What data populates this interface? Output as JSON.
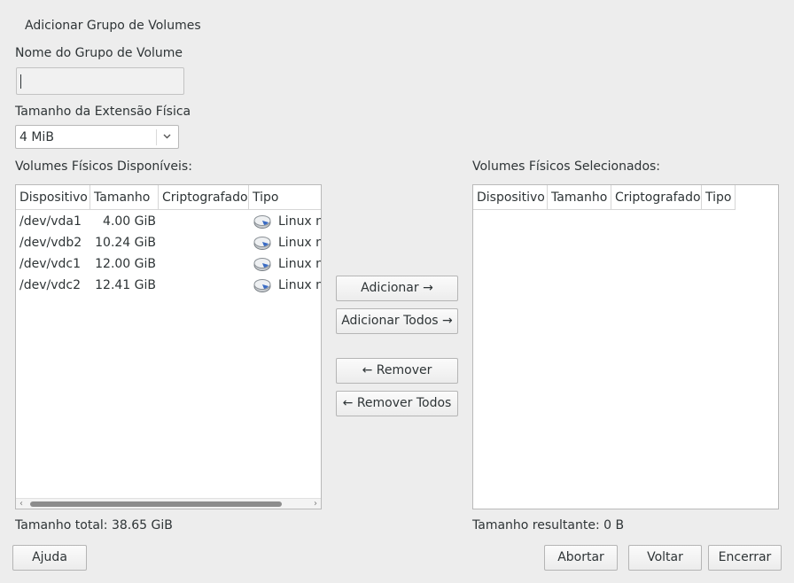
{
  "dialog": {
    "title": "Adicionar Grupo de Volumes"
  },
  "vg_name": {
    "label": "Nome do Grupo de Volume",
    "value": ""
  },
  "extent": {
    "label": "Tamanho da Extensão Física",
    "selected": "4 MiB"
  },
  "available": {
    "label": "Volumes Físicos Disponíveis:",
    "columns": [
      "Dispositivo",
      "Tamanho",
      "Criptografado",
      "Tipo"
    ],
    "rows": [
      {
        "device": "/dev/vda1",
        "size": "4.00 GiB",
        "encrypted": "",
        "type": "Linux na"
      },
      {
        "device": "/dev/vdb2",
        "size": "10.24 GiB",
        "encrypted": "",
        "type": "Linux na"
      },
      {
        "device": "/dev/vdc1",
        "size": "12.00 GiB",
        "encrypted": "",
        "type": "Linux na"
      },
      {
        "device": "/dev/vdc2",
        "size": "12.41 GiB",
        "encrypted": "",
        "type": "Linux na"
      }
    ],
    "total": "Tamanho total: 38.65 GiB"
  },
  "selected": {
    "label": "Volumes Físicos Selecionados:",
    "columns": [
      "Dispositivo",
      "Tamanho",
      "Criptografado",
      "Tipo"
    ],
    "rows": [],
    "total": "Tamanho resultante: 0 B"
  },
  "actions": {
    "add": "Adicionar →",
    "add_all": "Adicionar Todos →",
    "remove": "← Remover",
    "remove_all": "← Remover Todos"
  },
  "footer": {
    "help": "Ajuda",
    "abort": "Abortar",
    "back": "Voltar",
    "finish": "Encerrar"
  },
  "icons": {
    "disk": "hard-disk-icon",
    "dropdown": "chevron-down-icon"
  }
}
